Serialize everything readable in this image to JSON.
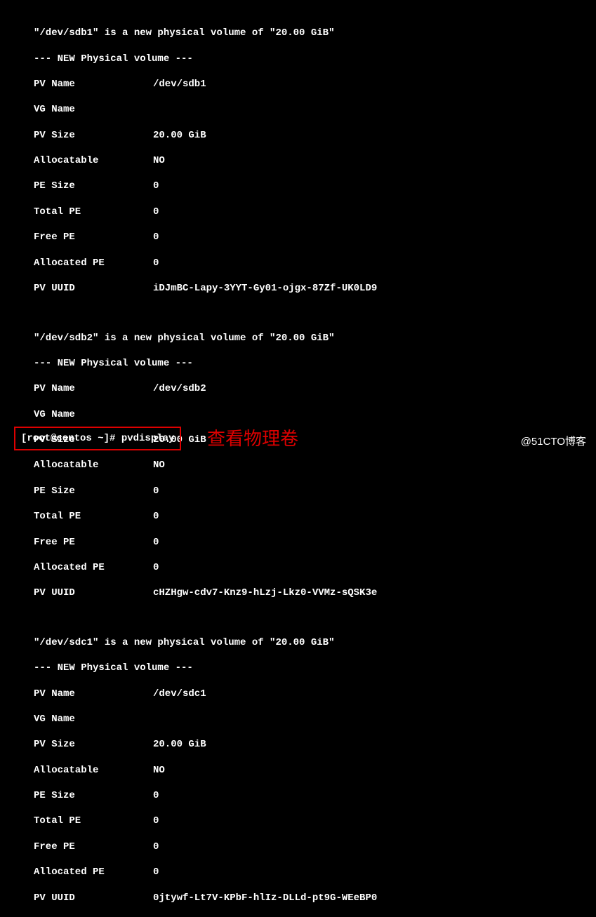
{
  "volumes": [
    {
      "intro": "\"/dev/sdb1\" is a new physical volume of \"20.00 GiB\"",
      "header": "--- NEW Physical volume ---",
      "pv_name_label": "PV Name",
      "pv_name": "/dev/sdb1",
      "vg_name_label": "VG Name",
      "vg_name": "",
      "pv_size_label": "PV Size",
      "pv_size": "20.00 GiB",
      "allocatable_label": "Allocatable",
      "allocatable": "NO",
      "pe_size_label": "PE Size",
      "pe_size": "0",
      "total_pe_label": "Total PE",
      "total_pe": "0",
      "free_pe_label": "Free PE",
      "free_pe": "0",
      "allocated_pe_label": "Allocated PE",
      "allocated_pe": "0",
      "pv_uuid_label": "PV UUID",
      "pv_uuid": "iDJmBC-Lapy-3YYT-Gy01-ojgx-87Zf-UK0LD9"
    },
    {
      "intro": "\"/dev/sdb2\" is a new physical volume of \"20.00 GiB\"",
      "header": "--- NEW Physical volume ---",
      "pv_name_label": "PV Name",
      "pv_name": "/dev/sdb2",
      "vg_name_label": "VG Name",
      "vg_name": "",
      "pv_size_label": "PV Size",
      "pv_size": "20.00 GiB",
      "allocatable_label": "Allocatable",
      "allocatable": "NO",
      "pe_size_label": "PE Size",
      "pe_size": "0",
      "total_pe_label": "Total PE",
      "total_pe": "0",
      "free_pe_label": "Free PE",
      "free_pe": "0",
      "allocated_pe_label": "Allocated PE",
      "allocated_pe": "0",
      "pv_uuid_label": "PV UUID",
      "pv_uuid": "cHZHgw-cdv7-Knz9-hLzj-Lkz0-VVMz-sQSK3e"
    },
    {
      "intro": "\"/dev/sdc1\" is a new physical volume of \"20.00 GiB\"",
      "header": "--- NEW Physical volume ---",
      "pv_name_label": "PV Name",
      "pv_name": "/dev/sdc1",
      "vg_name_label": "VG Name",
      "vg_name": "",
      "pv_size_label": "PV Size",
      "pv_size": "20.00 GiB",
      "allocatable_label": "Allocatable",
      "allocatable": "NO",
      "pe_size_label": "PE Size",
      "pe_size": "0",
      "total_pe_label": "Total PE",
      "total_pe": "0",
      "free_pe_label": "Free PE",
      "free_pe": "0",
      "allocated_pe_label": "Allocated PE",
      "allocated_pe": "0",
      "pv_uuid_label": "PV UUID",
      "pv_uuid": "0jtywf-Lt7V-KPbF-hlIz-DLLd-pt9G-WEeBP0"
    }
  ],
  "prompt": "[root@centos ~]# pvdisplay",
  "annotation": "查看物理卷",
  "watermark": "@51CTO博客"
}
